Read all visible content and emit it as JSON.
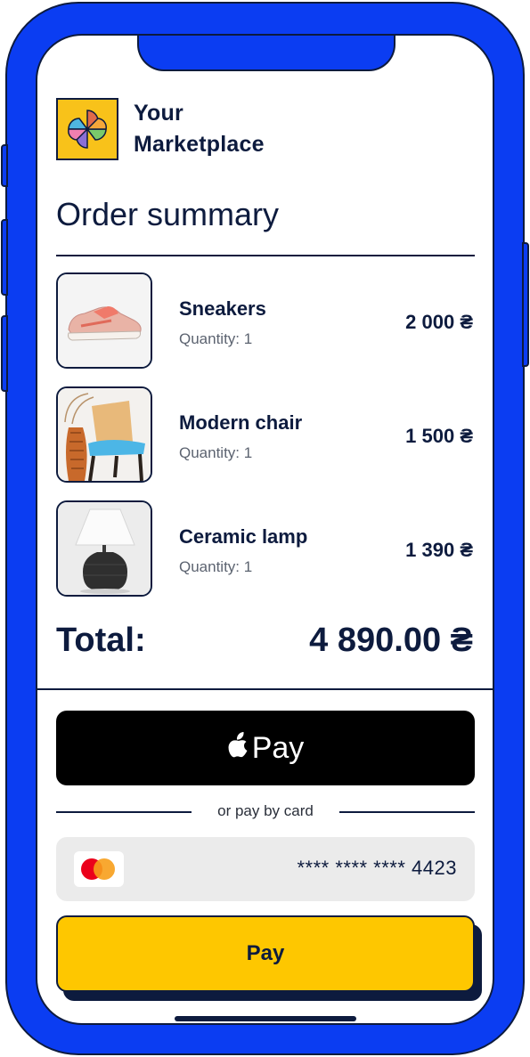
{
  "brand": {
    "line1": "Your",
    "line2": "Marketplace",
    "logo_color": "#f8c21a"
  },
  "page_title": "Order summary",
  "items": [
    {
      "name": "Sneakers",
      "quantity": "Quantity: 1",
      "price": "2 000 ₴",
      "thumb_icon": "sneaker-image"
    },
    {
      "name": "Modern chair",
      "quantity": "Quantity: 1",
      "price": "1 500 ₴",
      "thumb_icon": "chair-image"
    },
    {
      "name": "Ceramic lamp",
      "quantity": "Quantity: 1",
      "price": "1 390 ₴",
      "thumb_icon": "lamp-image"
    }
  ],
  "total": {
    "label": "Total:",
    "value": "4 890.00 ₴"
  },
  "apple_pay": {
    "glyph": "",
    "label": "Pay"
  },
  "or_text": "or pay by card",
  "card": {
    "number": "**** **** **** 4423",
    "brand_icon": "mastercard-icon"
  },
  "pay_button": {
    "label": "Pay",
    "color": "#fec700"
  },
  "colors": {
    "frame": "#0b3df2",
    "ink": "#0d1b3e"
  }
}
